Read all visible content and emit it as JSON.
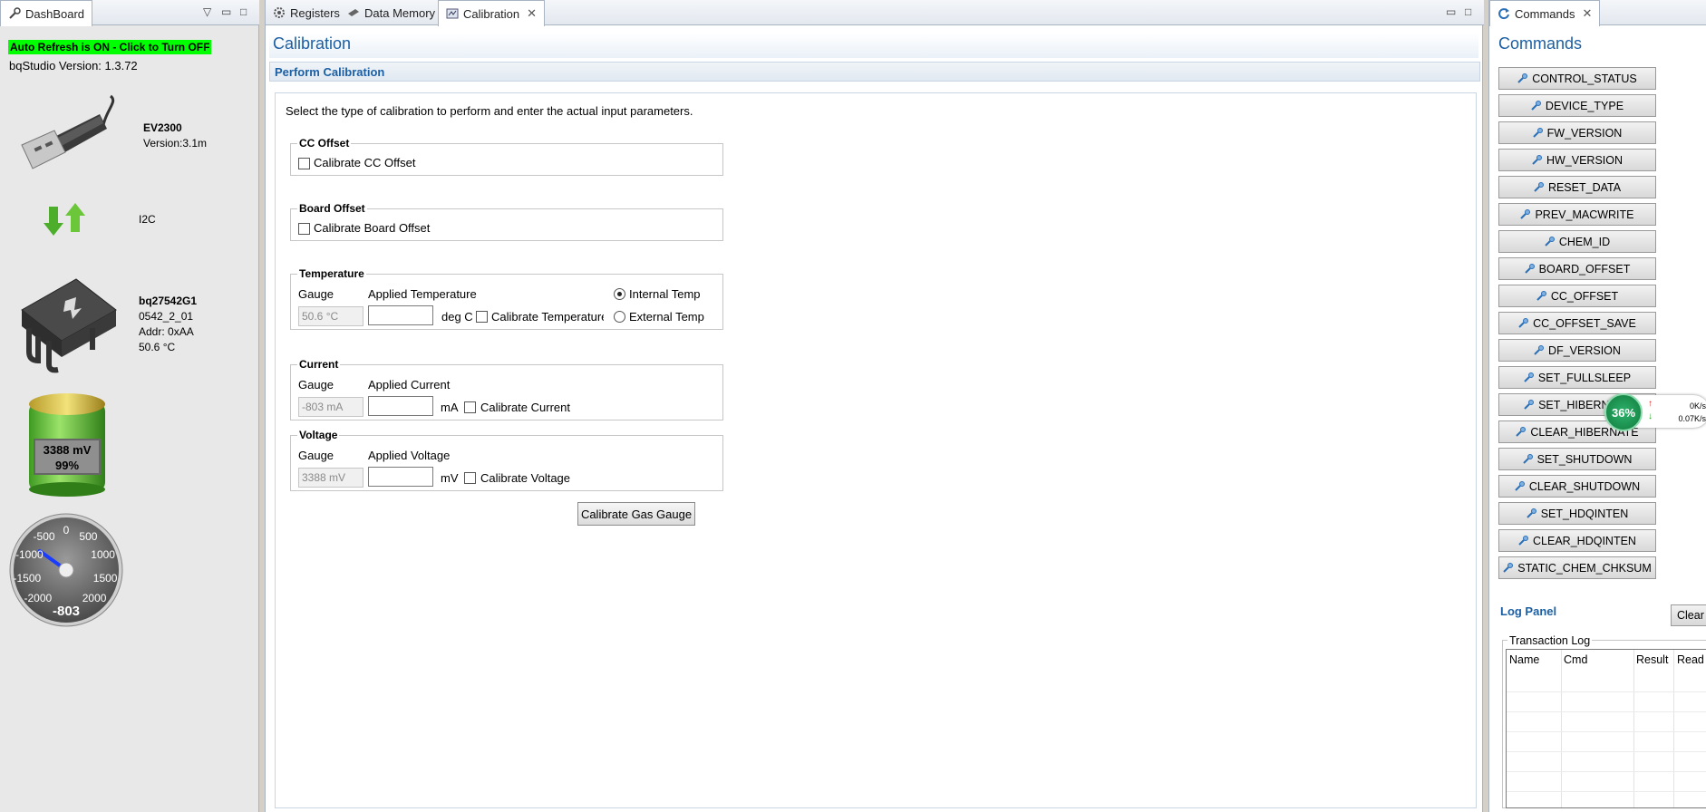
{
  "dashboard": {
    "tab_label": "DashBoard",
    "auto_refresh": "Auto Refresh is ON - Click to Turn OFF",
    "bqstudio_version": "bqStudio Version:  1.3.72",
    "adapter": {
      "name": "EV2300",
      "version": "Version:3.1m"
    },
    "bus": "I2C",
    "device": {
      "name": "bq27542G1",
      "fw": "0542_2_01",
      "addr": "Addr: 0xAA",
      "temp": "50.6 °C"
    },
    "battery": {
      "voltage": "3388 mV",
      "soc": "99%",
      "level": 0.99
    },
    "gauge": {
      "ticks": [
        "-2000",
        "-1500",
        "-1000",
        "-500",
        "0",
        "500",
        "1000",
        "1500",
        "2000"
      ],
      "value_label": "-803",
      "value": -803,
      "min": -2000,
      "max": 2000
    }
  },
  "center": {
    "tabs": [
      {
        "label": "Registers",
        "icon": "gear-icon"
      },
      {
        "label": "Data Memory",
        "icon": "memory-icon"
      },
      {
        "label": "Calibration",
        "icon": "calibration-icon"
      }
    ],
    "title": "Calibration",
    "section_title": "Perform Calibration",
    "instructions": "Select the type of calibration to perform and enter the actual input parameters.",
    "cc_offset": {
      "group": "CC Offset",
      "checkbox": "Calibrate CC Offset"
    },
    "board_offset": {
      "group": "Board Offset",
      "checkbox": "Calibrate Board Offset"
    },
    "temperature": {
      "group": "Temperature",
      "gauge_label": "Gauge",
      "applied_label": "Applied Temperature",
      "gauge_value": "50.6 °C",
      "unit": "deg C",
      "checkbox": "Calibrate Temperature",
      "radio_internal": "Internal Temp",
      "radio_external": "External Temp"
    },
    "current": {
      "group": "Current",
      "gauge_label": "Gauge",
      "applied_label": "Applied Current",
      "gauge_value": "-803 mA",
      "unit": "mA",
      "checkbox": "Calibrate Current"
    },
    "voltage": {
      "group": "Voltage",
      "gauge_label": "Gauge",
      "applied_label": "Applied Voltage",
      "gauge_value": "3388 mV",
      "unit": "mV",
      "checkbox": "Calibrate Voltage"
    },
    "calibrate_button": "Calibrate Gas Gauge"
  },
  "commands": {
    "tab_label": "Commands",
    "title": "Commands",
    "items": [
      "CONTROL_STATUS",
      "DEVICE_TYPE",
      "FW_VERSION",
      "HW_VERSION",
      "RESET_DATA",
      "PREV_MACWRITE",
      "CHEM_ID",
      "BOARD_OFFSET",
      "CC_OFFSET",
      "CC_OFFSET_SAVE",
      "DF_VERSION",
      "SET_FULLSLEEP",
      "SET_HIBERNATE",
      "CLEAR_HIBERNATE",
      "SET_SHUTDOWN",
      "CLEAR_SHUTDOWN",
      "SET_HDQINTEN",
      "CLEAR_HDQINTEN",
      "STATIC_CHEM_CHKSUM"
    ],
    "log_panel": "Log Panel",
    "clear_button": "Clear",
    "transaction_log": "Transaction Log",
    "columns": [
      "Name",
      "Cmd",
      "Result",
      "Read ..."
    ]
  },
  "speed_widget": {
    "percent": "36%",
    "up": "0K/s",
    "down": "0.07K/s"
  },
  "colors": {
    "accent": "#1c5fa3",
    "auto_refresh_bg": "#00ff00",
    "battery": "#4caf2a"
  }
}
